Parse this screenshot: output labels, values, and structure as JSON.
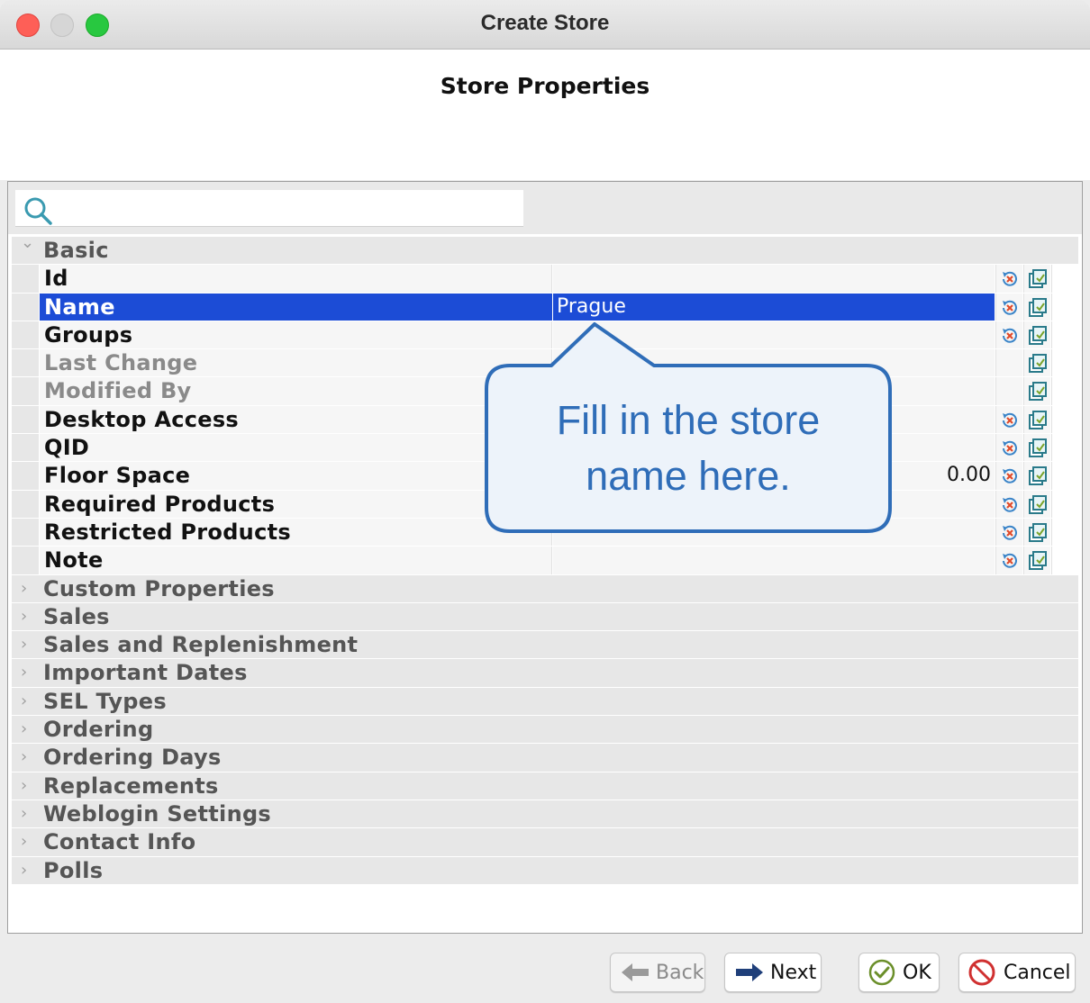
{
  "window": {
    "title": "Create Store"
  },
  "header": {
    "title": "Store Properties"
  },
  "search": {
    "placeholder": "",
    "value": ""
  },
  "groups_top": [
    {
      "label": "Basic",
      "expanded": true
    }
  ],
  "properties": [
    {
      "name": "Id",
      "value": "",
      "enabled": true,
      "reset": true,
      "edit": true
    },
    {
      "name": "Name",
      "value": "Prague",
      "enabled": true,
      "selected": true,
      "reset": true,
      "edit": true
    },
    {
      "name": "Groups",
      "value": "",
      "enabled": true,
      "reset": true,
      "edit": true
    },
    {
      "name": "Last Change",
      "value": "",
      "enabled": false,
      "reset": false,
      "edit": true
    },
    {
      "name": "Modified By",
      "value": "",
      "enabled": false,
      "reset": false,
      "edit": true
    },
    {
      "name": "Desktop Access",
      "value": "",
      "enabled": true,
      "reset": true,
      "edit": true
    },
    {
      "name": "QID",
      "value": "",
      "enabled": true,
      "reset": true,
      "edit": true
    },
    {
      "name": "Floor Space",
      "value": "0.00",
      "enabled": true,
      "reset": true,
      "edit": true,
      "align": "right"
    },
    {
      "name": "Required Products",
      "value": "",
      "enabled": true,
      "reset": true,
      "edit": true
    },
    {
      "name": "Restricted Products",
      "value": "",
      "enabled": true,
      "reset": true,
      "edit": true
    },
    {
      "name": "Note",
      "value": "",
      "enabled": true,
      "reset": true,
      "edit": true
    }
  ],
  "groups_collapsed": [
    "Custom Properties",
    "Sales",
    "Sales and Replenishment",
    "Important Dates",
    "SEL Types",
    "Ordering",
    "Ordering Days",
    "Replacements",
    "Weblogin Settings",
    "Contact Info",
    "Polls"
  ],
  "callout": {
    "line1": "Fill in the store",
    "line2": "name here.",
    "color": "#2f6db8"
  },
  "buttons": {
    "back": "Back",
    "next": "Next",
    "ok": "OK",
    "cancel": "Cancel"
  },
  "colors": {
    "selection": "#1c4cd6",
    "close": "#fe5f57",
    "maximize": "#28c840"
  }
}
